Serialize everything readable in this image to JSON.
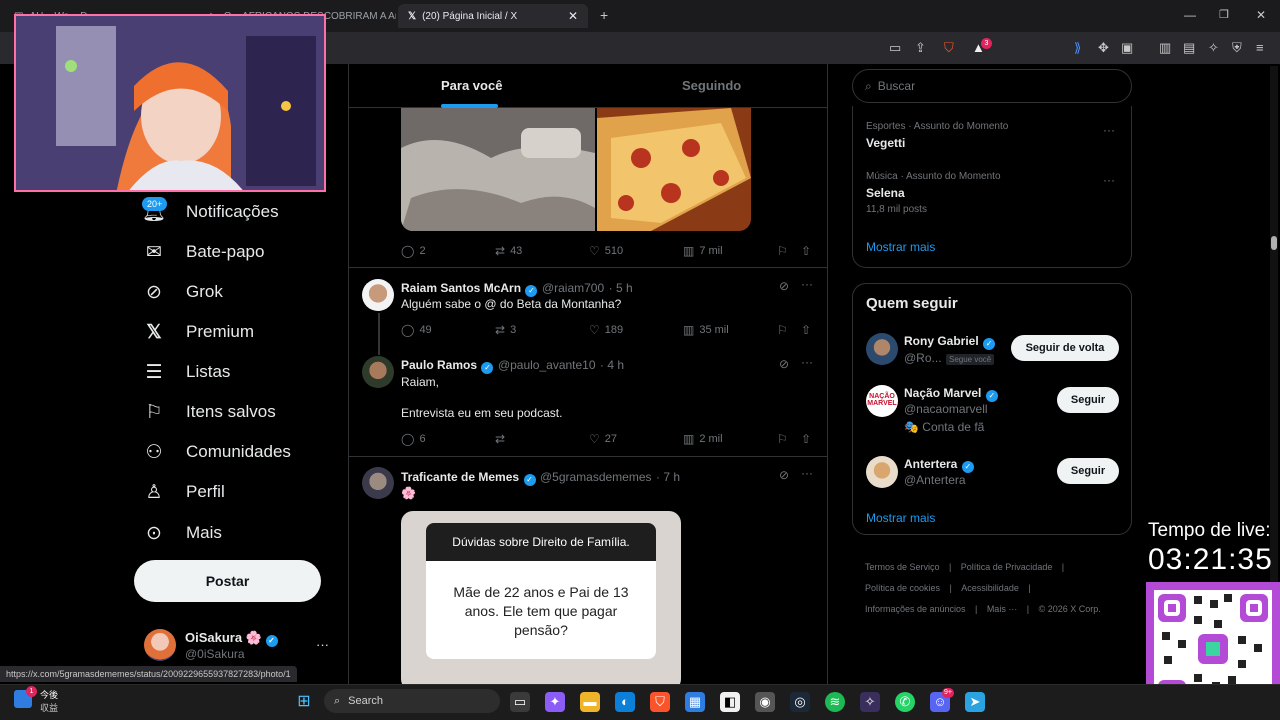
{
  "browser": {
    "tabs": [
      {
        "label": "AH... Wa... D... -"
      },
      {
        "label": "O... AFRICANOS DESCOBRIRAM A Am"
      },
      {
        "label": "(20) Página Inicial / X"
      }
    ],
    "new_tab": "+",
    "extension_badge": "3",
    "status_url": "https://x.com/5gramasdememes/status/2009229655937827283/photo/1"
  },
  "sidebar": {
    "notifications_badge": "20+",
    "items": [
      {
        "label": "Notificações",
        "icon": "bell-icon"
      },
      {
        "label": "Bate-papo",
        "icon": "mail-icon"
      },
      {
        "label": "Grok",
        "icon": "grok-icon"
      },
      {
        "label": "Premium",
        "icon": "x-logo-icon"
      },
      {
        "label": "Listas",
        "icon": "list-icon"
      },
      {
        "label": "Itens salvos",
        "icon": "bookmark-icon"
      },
      {
        "label": "Comunidades",
        "icon": "communities-icon"
      },
      {
        "label": "Perfil",
        "icon": "person-icon"
      },
      {
        "label": "Mais",
        "icon": "more-circle-icon"
      }
    ],
    "post_label": "Postar",
    "account": {
      "name": "OiSakura 🌸",
      "handle": "@0iSakura",
      "more": "···"
    }
  },
  "timeline": {
    "tabs": [
      {
        "label": "Para você"
      },
      {
        "label": "Seguindo"
      }
    ],
    "post1": {
      "replies": "2",
      "reposts": "43",
      "likes": "510",
      "views": "7 mil"
    },
    "post2": {
      "name": "Raiam Santos McArn",
      "handle": "@raiam700",
      "time": "· 5 h",
      "text": "Alguém sabe o @ do Beta da Montanha?",
      "replies": "49",
      "reposts": "3",
      "likes": "189",
      "views": "35 mil"
    },
    "post3": {
      "name": "Paulo Ramos",
      "handle": "@paulo_avante10",
      "time": "· 4 h",
      "text_line1": "Raiam,",
      "text_line2": "Entrevista eu em seu podcast.",
      "replies": "6",
      "reposts": "",
      "likes": "27",
      "views": "2 mil"
    },
    "post4": {
      "name": "Traficante de Memes",
      "handle": "@5gramasdememes",
      "time": "· 7 h",
      "text": "🌸",
      "image_title": "Dúvidas sobre Direito de Família.",
      "image_question": "Mãe de 22 anos e Pai de 13 anos. Ele tem que pagar pensão?"
    }
  },
  "right": {
    "search_placeholder": "Buscar",
    "trends": [
      {
        "category": "Esportes · Assunto do Momento",
        "title": "Vegetti",
        "posts": ""
      },
      {
        "category": "Música · Assunto do Momento",
        "title": "Selena",
        "posts": "11,8 mil posts"
      }
    ],
    "show_more": "Mostrar mais",
    "who_to_follow": {
      "title": "Quem seguir",
      "users": [
        {
          "name": "Rony Gabriel",
          "handle": "@Ro...",
          "tag": "Segue você",
          "button": "Seguir de volta",
          "note": ""
        },
        {
          "name": "Nação Marvel",
          "handle": "@nacaomarvell",
          "tag": "",
          "button": "Seguir",
          "note": "🎭 Conta de fã"
        },
        {
          "name": "Antertera",
          "handle": "@Antertera",
          "tag": "",
          "button": "Seguir",
          "note": ""
        }
      ],
      "show_more": "Mostrar mais"
    },
    "footer": {
      "line1": [
        "Termos de Serviço",
        "Política de Privacidade"
      ],
      "line2": [
        "Política de cookies",
        "Acessibilidade"
      ],
      "line3": [
        "Informações de anúncios",
        "Mais ···",
        "© 2026 X Corp."
      ]
    }
  },
  "stream_overlay": {
    "timer_label": "Tempo de live:",
    "timer_value": "03:21:35"
  },
  "taskbar": {
    "weather_line1": "今後",
    "weather_line2": "収益",
    "search_label": "Search",
    "notification_count": "1",
    "discord_badge": "9+"
  },
  "colors": {
    "accent": "#1d9bf0",
    "background": "#000000",
    "border": "#2f3336",
    "muted": "#71767b"
  }
}
